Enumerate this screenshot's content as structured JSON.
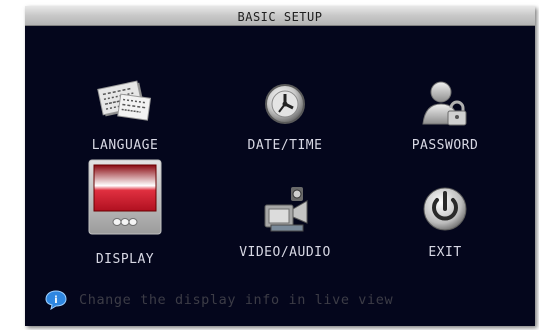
{
  "window": {
    "title": "BASIC SETUP"
  },
  "menu": {
    "items": [
      {
        "label": "LANGUAGE",
        "icon": "language-icon"
      },
      {
        "label": "DATE/TIME",
        "icon": "clock-icon"
      },
      {
        "label": "PASSWORD",
        "icon": "user-lock-icon"
      },
      {
        "label": "DISPLAY",
        "icon": "display-icon",
        "selected": true
      },
      {
        "label": "VIDEO/AUDIO",
        "icon": "camera-icon"
      },
      {
        "label": "EXIT",
        "icon": "power-icon"
      }
    ]
  },
  "status": {
    "icon": "info-bubble-icon",
    "text": "Change the display info in live view"
  },
  "colors": {
    "background": "#04061c",
    "label": "#d8d8e4",
    "selected_red": "#d42030",
    "status_text": "#3c3c46",
    "info_blue": "#2e86e0"
  }
}
